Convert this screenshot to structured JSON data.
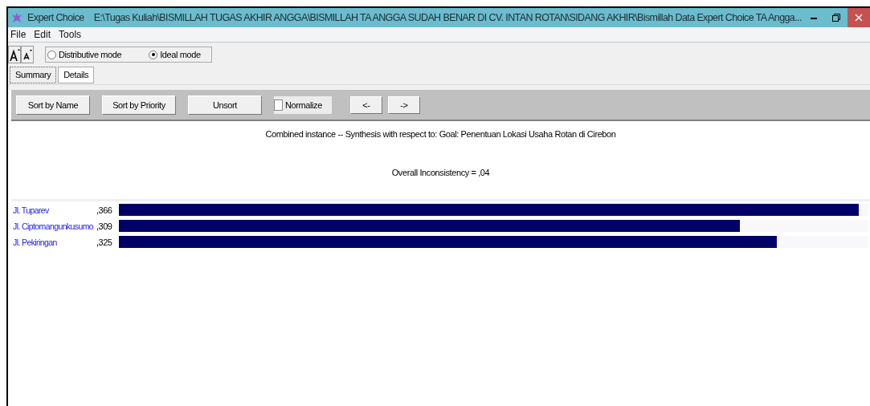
{
  "window": {
    "app_name": "Expert Choice",
    "title": "E:\\Tugas Kuliah\\BISMILLAH TUGAS AKHIR ANGGA\\BISMILLAH TA ANGGA SUDAH BENAR DI CV. INTAN ROTAN\\SIDANG AKHIR\\Bismillah Data Expert Choice TA Angga..."
  },
  "menu": [
    "File",
    "Edit",
    "Tools"
  ],
  "modes": [
    {
      "label": "Distributive mode",
      "selected": false
    },
    {
      "label": "Ideal mode",
      "selected": true
    }
  ],
  "tabs": [
    {
      "label": "Summary",
      "selected": true
    },
    {
      "label": "Details",
      "selected": false
    }
  ],
  "toolbar": {
    "buttons": [
      {
        "label": "Sort by Name"
      },
      {
        "label": "Sort by Priority"
      },
      {
        "label": "Unsort"
      }
    ],
    "normalize": {
      "label": "Normalize",
      "checked": false
    },
    "nav": [
      "<-",
      "->"
    ]
  },
  "heading": "Combined instance -- Synthesis with respect to: Goal: Penentuan Lokasi Usaha Rotan di Cirebon",
  "inconsistency": "Overall Inconsistency = ,04",
  "results": [
    {
      "name": "Jl. Tuparev",
      "value": ",366",
      "level": 0.987
    },
    {
      "name": "Jl. Ciptomangunkusumo",
      "value": ",309",
      "level": 0.828
    },
    {
      "name": "Jl. Pekiringan",
      "value": ",325",
      "level": 0.878
    }
  ]
}
